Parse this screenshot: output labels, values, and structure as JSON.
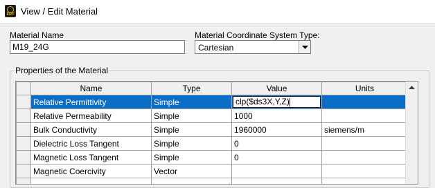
{
  "window": {
    "title": "View / Edit Material"
  },
  "material_name": {
    "label": "Material Name",
    "value": "M19_24G"
  },
  "coord_system": {
    "label": "Material Coordinate System Type:",
    "value": "Cartesian"
  },
  "properties": {
    "label": "Properties of the Material",
    "columns": [
      "Name",
      "Type",
      "Value",
      "Units"
    ],
    "rows": [
      {
        "name": "Relative Permittivity",
        "type": "Simple",
        "value": "clp($ds3X,Y,Z)",
        "units": ""
      },
      {
        "name": "Relative Permeability",
        "type": "Simple",
        "value": "1000",
        "units": ""
      },
      {
        "name": "Bulk Conductivity",
        "type": "Simple",
        "value": "1960000",
        "units": "siemens/m"
      },
      {
        "name": "Dielectric Loss Tangent",
        "type": "Simple",
        "value": "0",
        "units": ""
      },
      {
        "name": "Magnetic Loss Tangent",
        "type": "Simple",
        "value": "0",
        "units": ""
      },
      {
        "name": "Magnetic Coercivity",
        "type": "Vector",
        "value": "",
        "units": ""
      }
    ]
  },
  "colors": {
    "selection": "#0a6dc8",
    "window_bg": "#f0f0f0"
  },
  "icons": {
    "app": "edt-app-icon",
    "dropdown": "chevron-down-icon",
    "scroll_up": "chevron-up-icon"
  }
}
